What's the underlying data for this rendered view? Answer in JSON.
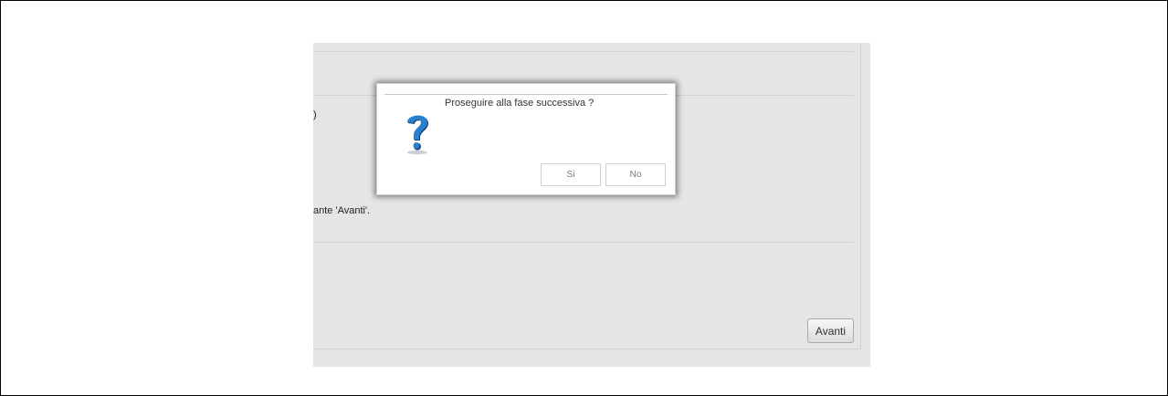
{
  "background_page": {
    "fragment_1": ")",
    "fragment_2": "ante 'Avanti'.",
    "next_button_label": "Avanti"
  },
  "dialog": {
    "message": "Proseguire alla fase successiva ?",
    "icon": "question-mark-icon",
    "yes_label": "Si",
    "no_label": "No"
  },
  "colors": {
    "panel_background": "#e5e5e5",
    "icon_blue": "#1f6fb5",
    "icon_shadow": "#1b3f6a"
  }
}
